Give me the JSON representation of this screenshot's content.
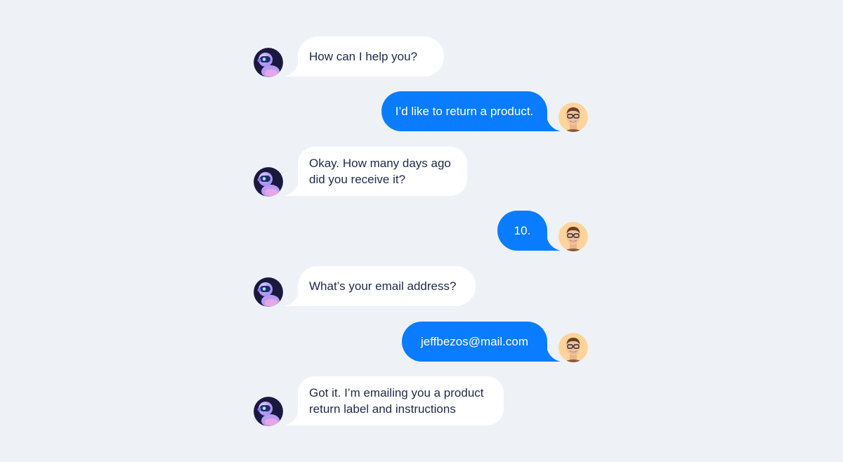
{
  "colors": {
    "background": "#eef2f7",
    "bot_bubble": "#ffffff",
    "user_bubble": "#0a7cff",
    "bot_text": "#1e2a4a",
    "user_text": "#ffffff"
  },
  "messages": [
    {
      "sender": "bot",
      "avatar_icon": "robot-avatar-icon",
      "lines": [
        "How can I help you?"
      ]
    },
    {
      "sender": "user",
      "avatar_icon": "user-avatar-icon",
      "lines": [
        "I’d like to return a product."
      ]
    },
    {
      "sender": "bot",
      "avatar_icon": "robot-avatar-icon",
      "lines": [
        "Okay. How many days ago",
        "did you receive it?"
      ]
    },
    {
      "sender": "user",
      "avatar_icon": "user-avatar-icon",
      "lines": [
        "10."
      ]
    },
    {
      "sender": "bot",
      "avatar_icon": "robot-avatar-icon",
      "lines": [
        "What’s your email address?"
      ]
    },
    {
      "sender": "user",
      "avatar_icon": "user-avatar-icon",
      "lines": [
        "jeffbezos@mail.com"
      ]
    },
    {
      "sender": "bot",
      "avatar_icon": "robot-avatar-icon",
      "lines": [
        "Got it. I’m emailing you a product",
        "return label and instructions"
      ]
    }
  ]
}
